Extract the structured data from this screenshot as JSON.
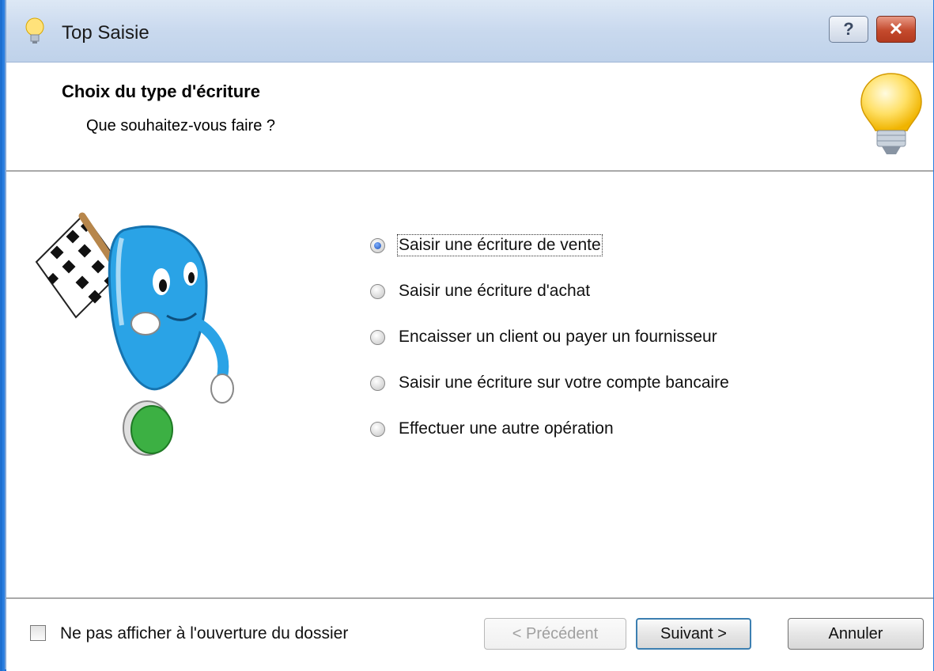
{
  "window": {
    "title": "Top Saisie",
    "help_label": "?",
    "close_label": "✕"
  },
  "header": {
    "title": "Choix du type d'écriture",
    "subtitle": "Que souhaitez-vous faire ?"
  },
  "options": [
    {
      "label": "Saisir une écriture de vente",
      "checked": true
    },
    {
      "label": "Saisir une écriture d'achat",
      "checked": false
    },
    {
      "label": "Encaisser un client ou payer un fournisseur",
      "checked": false
    },
    {
      "label": "Saisir une écriture sur votre compte bancaire",
      "checked": false
    },
    {
      "label": "Effectuer une autre opération",
      "checked": false
    }
  ],
  "footer": {
    "checkbox_label": "Ne pas afficher à l'ouverture du dossier",
    "checkbox_checked": false,
    "prev_label": "< Précédent",
    "next_label": "Suivant >",
    "cancel_label": "Annuler"
  },
  "colors": {
    "titlebar": "#c9d9ee",
    "desktop": "#1d6fd0",
    "close_button": "#c44a2d",
    "default_button_border": "#3c7fb1"
  }
}
